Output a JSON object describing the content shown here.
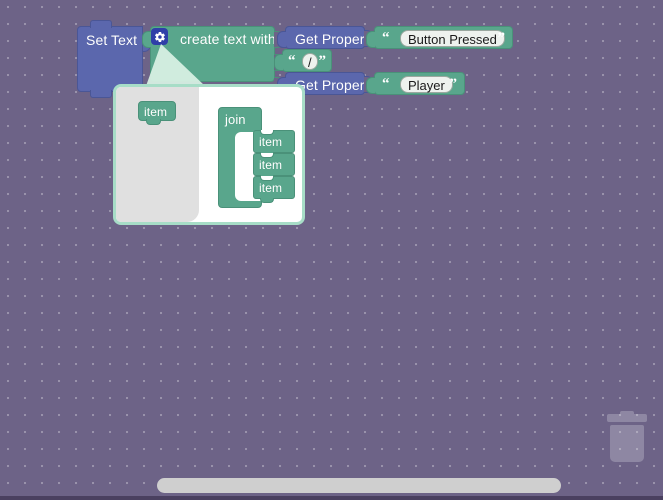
{
  "workspace": {
    "background_color": "#6d6387",
    "grid_dot_color": "#ffffff",
    "grid_spacing": 17
  },
  "blocks": {
    "set_text": {
      "label": "Set Text",
      "color": "#5b67ad",
      "kind": "statement"
    },
    "create_text_with": {
      "label": "create text with",
      "color": "#59a68c",
      "kind": "value",
      "mutator_icon": "gear-icon"
    },
    "get_property_1": {
      "label": "Get Property",
      "color": "#5b67ad"
    },
    "get_property_2": {
      "label": "Get Property",
      "color": "#5b67ad"
    },
    "text_button_pressed": {
      "quote_open": "“",
      "quote_close": "”",
      "value": "Button Pressed",
      "color": "#59a68c"
    },
    "text_slash": {
      "quote_open": "“",
      "quote_close": "”",
      "value": "/",
      "color": "#59a68c"
    },
    "text_player": {
      "quote_open": "“",
      "quote_close": "”",
      "value": "Player",
      "color": "#59a68c"
    }
  },
  "mutator": {
    "border_color": "#a7ddc7",
    "flyout_background": "#e0e0e0",
    "flyout_blocks": [
      {
        "label": "item"
      }
    ],
    "container_block": {
      "label": "join",
      "items": [
        {
          "label": "item"
        },
        {
          "label": "item"
        },
        {
          "label": "item"
        }
      ]
    }
  },
  "controls": {
    "trash_can": "trash-can-icon",
    "horizontal_scrollbar": "h-scrollbar"
  }
}
